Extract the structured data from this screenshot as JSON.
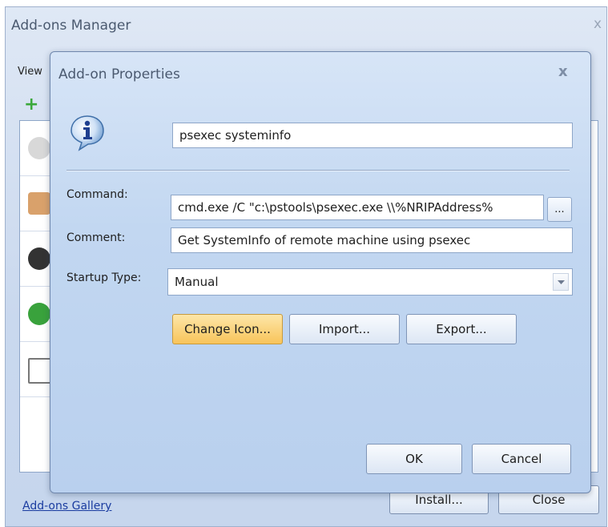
{
  "manager": {
    "title": "Add-ons Manager",
    "close_glyph": "x",
    "view_label": "View",
    "add_icon": "plus-icon",
    "gallery_link": "Add-ons Gallery",
    "install_button": "Install...",
    "close_button": "Close"
  },
  "dialog": {
    "title": "Add-on Properties",
    "close_glyph": "x",
    "icon": "info-icon",
    "name_value": "psexec systeminfo",
    "command_label": "Command:",
    "command_value": "cmd.exe /C \"c:\\pstools\\psexec.exe \\\\%NRIPAddress%",
    "browse_button": "...",
    "comment_label": "Comment:",
    "comment_value": "Get SystemInfo of remote machine using psexec",
    "startup_label": "Startup Type:",
    "startup_value": "Manual",
    "change_icon_button": "Change Icon...",
    "import_button": "Import...",
    "export_button": "Export...",
    "ok_button": "OK",
    "cancel_button": "Cancel"
  },
  "colors": {
    "accent_button": "#f8c45a",
    "link": "#1a3ca0"
  }
}
